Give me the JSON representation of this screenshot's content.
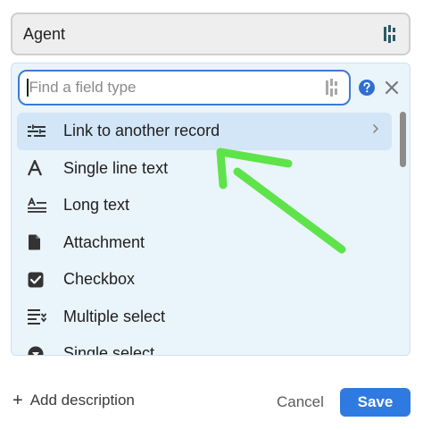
{
  "field_name": {
    "value": "Agent"
  },
  "search": {
    "placeholder": "Find a field type"
  },
  "field_types": [
    {
      "label": "Link to another record",
      "icon": "link-record-icon",
      "selected": true
    },
    {
      "label": "Single line text",
      "icon": "single-line-text-icon"
    },
    {
      "label": "Long text",
      "icon": "long-text-icon"
    },
    {
      "label": "Attachment",
      "icon": "attachment-icon"
    },
    {
      "label": "Checkbox",
      "icon": "checkbox-icon"
    },
    {
      "label": "Multiple select",
      "icon": "multiple-select-icon"
    },
    {
      "label": "Single select",
      "icon": "single-select-icon"
    }
  ],
  "footer": {
    "add_description": "Add description",
    "cancel_label": "Cancel",
    "save_label": "Save"
  },
  "colors": {
    "accent": "#2f7ae0",
    "selected_row": "#d3e6f7",
    "annotation_arrow": "#5ee44a"
  }
}
